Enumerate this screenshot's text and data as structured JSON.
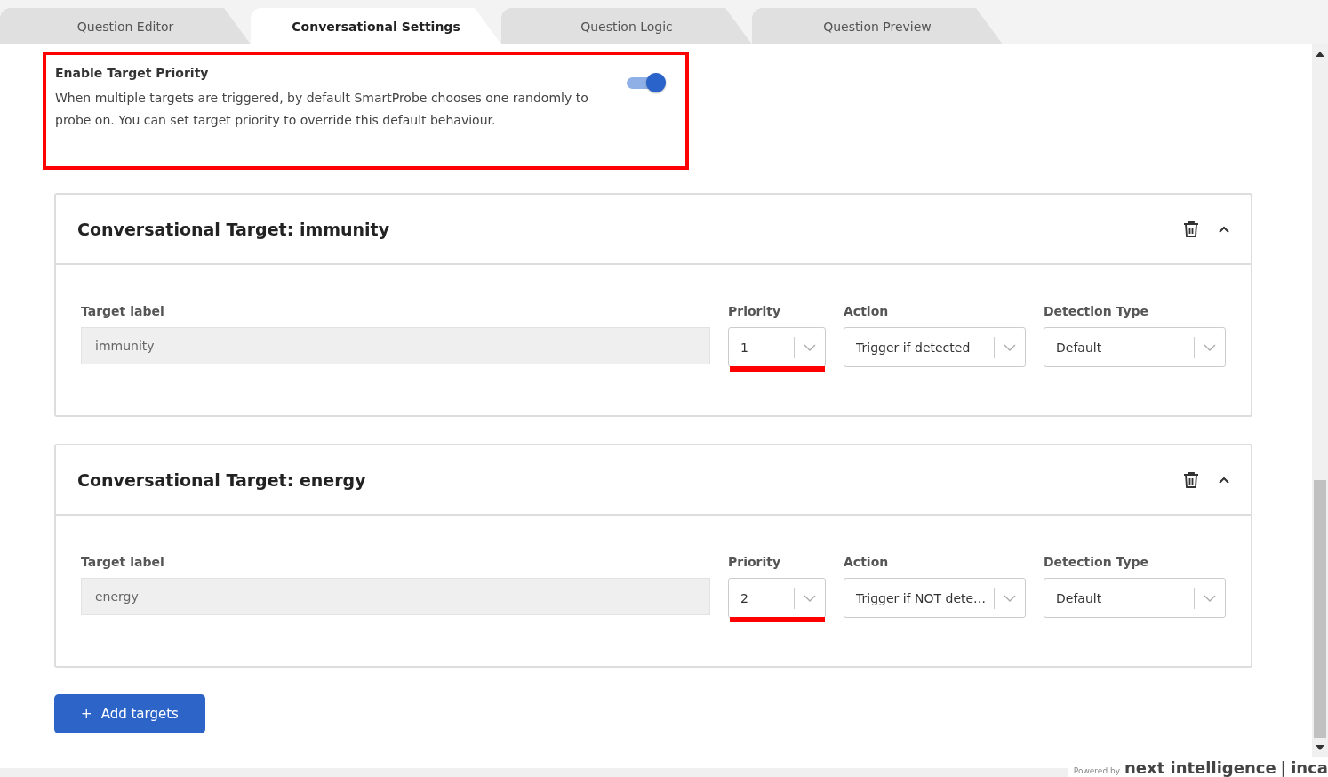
{
  "tabs": [
    {
      "label": "Question Editor",
      "selected": false
    },
    {
      "label": "Conversational Settings",
      "selected": true
    },
    {
      "label": "Question Logic",
      "selected": false
    },
    {
      "label": "Question Preview",
      "selected": false
    }
  ],
  "priority_setting": {
    "title": "Enable Target Priority",
    "description": "When multiple targets are triggered, by default SmartProbe chooses one randomly to probe on. You can set target priority to override this default behaviour.",
    "on": true,
    "highlighted": true
  },
  "targets": [
    {
      "title": "Conversational Target: immunity",
      "expanded": true,
      "fields": [
        {
          "kind": "text",
          "label": "Target label",
          "value": "immunity"
        },
        {
          "kind": "select",
          "label": "Priority",
          "value": "1",
          "highlighted": true
        },
        {
          "kind": "select",
          "label": "Action",
          "value": "Trigger if detected",
          "highlighted": false
        },
        {
          "kind": "select",
          "label": "Detection Type",
          "value": "Default",
          "highlighted": false
        }
      ]
    },
    {
      "title": "Conversational Target: energy",
      "expanded": true,
      "fields": [
        {
          "kind": "text",
          "label": "Target label",
          "value": "energy"
        },
        {
          "kind": "select",
          "label": "Priority",
          "value": "2",
          "highlighted": true
        },
        {
          "kind": "select",
          "label": "Action",
          "value": "Trigger if NOT dete…",
          "highlighted": false
        },
        {
          "kind": "select",
          "label": "Detection Type",
          "value": "Default",
          "highlighted": false
        }
      ]
    }
  ],
  "add_button": {
    "label": "Add targets",
    "icon": "+"
  },
  "footer": {
    "powered_by": "Powered by",
    "brand": "next intelligence",
    "separator": "|",
    "partner": "inca"
  }
}
